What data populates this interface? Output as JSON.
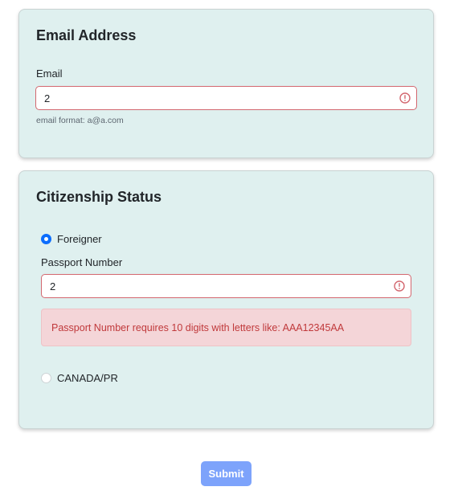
{
  "email_section": {
    "title": "Email Address",
    "field_label": "Email",
    "field_value": "2",
    "help_text": "email format: a@a.com"
  },
  "citizenship_section": {
    "title": "Citizenship Status",
    "options": [
      {
        "label": "Foreigner",
        "selected": true
      },
      {
        "label": "CANADA/PR",
        "selected": false
      }
    ],
    "passport_label": "Passport Number",
    "passport_value": "2",
    "passport_error": "Passport Number requires 10 digits with letters like: AAA12345AA"
  },
  "submit_label": "Submit",
  "icons": {
    "field_error": "exclamation-circle-icon"
  },
  "colors": {
    "card_background": "#dff0ef",
    "invalid_border": "#d3676f",
    "error_text": "#c0393b",
    "alert_background": "#f4d5d8",
    "radio_selected": "#0d6efd",
    "submit_background": "#7da3fb"
  }
}
